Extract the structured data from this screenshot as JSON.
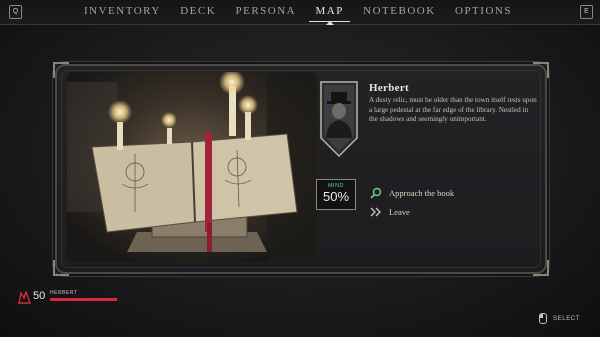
{
  "nav": {
    "left_key": "Q",
    "right_key": "E",
    "tabs": [
      {
        "label": "INVENTORY"
      },
      {
        "label": "DECK"
      },
      {
        "label": "PERSONA"
      },
      {
        "label": "MAP",
        "active": true
      },
      {
        "label": "NOTEBOOK"
      },
      {
        "label": "OPTIONS"
      }
    ]
  },
  "encounter": {
    "name": "Herbert",
    "description": "A dusty relic, must be older than the town itself rests upon a large pedestal at the far edge of the library. Nestled in the shadows and seemingly unimportant.",
    "mind": {
      "label": "MIND",
      "value": "50%"
    },
    "choices": [
      {
        "label": "Approach the book",
        "icon": "search-icon"
      },
      {
        "label": "Leave",
        "icon": "double-chevron-icon"
      }
    ]
  },
  "player": {
    "health": "50",
    "name": "HERBERT",
    "health_fraction": 0.95
  },
  "hint": {
    "select": "SELECT"
  },
  "colors": {
    "accent_green": "#6fd08a",
    "health_red": "#d62a3a"
  }
}
